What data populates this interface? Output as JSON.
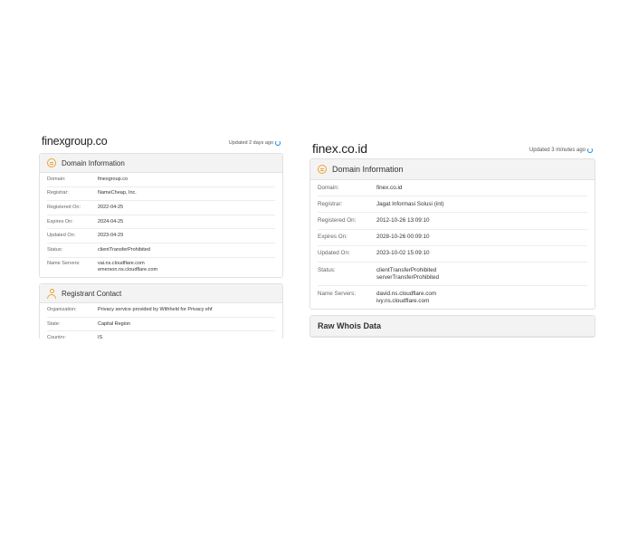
{
  "left": {
    "domain": "finexgroup.co",
    "updated": "Updated 2 days ago",
    "domain_info": {
      "heading": "Domain Information",
      "rows": [
        {
          "label": "Domain:",
          "value": [
            "finexgroup.co"
          ]
        },
        {
          "label": "Registrar:",
          "value": [
            "NameCheap, Inc."
          ]
        },
        {
          "label": "Registered On:",
          "value": [
            "2022-04-25"
          ]
        },
        {
          "label": "Expires On:",
          "value": [
            "2024-04-25"
          ]
        },
        {
          "label": "Updated On:",
          "value": [
            "2023-04-29"
          ]
        },
        {
          "label": "Status:",
          "value": [
            "clientTransferProhibited"
          ]
        },
        {
          "label": "Name Servers:",
          "value": [
            "vai.ns.cloudflare.com",
            "emerson.ns.cloudflare.com"
          ]
        }
      ]
    },
    "registrant": {
      "heading": "Registrant Contact",
      "rows": [
        {
          "label": "Organization:",
          "value": [
            "Privacy service provided by Withheld for Privacy ehf"
          ]
        },
        {
          "label": "State:",
          "value": [
            "Capital Region"
          ]
        },
        {
          "label": "Country:",
          "value": [
            "IS"
          ]
        }
      ]
    }
  },
  "right": {
    "domain": "finex.co.id",
    "updated": "Updated 3 minutes ago",
    "domain_info": {
      "heading": "Domain Information",
      "rows": [
        {
          "label": "Domain:",
          "value": [
            "finex.co.id"
          ]
        },
        {
          "label": "Registrar:",
          "value": [
            "Jagat Informasi Solusi (int)"
          ]
        },
        {
          "label": "Registered On:",
          "value": [
            "2012-10-26 13:09:10"
          ]
        },
        {
          "label": "Expires On:",
          "value": [
            "2028-10-26 00:09:10"
          ]
        },
        {
          "label": "Updated On:",
          "value": [
            "2023-10-02 15:09:10"
          ]
        },
        {
          "label": "Status:",
          "value": [
            "clientTransferProhibited",
            "serverTransferProhibited"
          ]
        },
        {
          "label": "Name Servers:",
          "value": [
            "david.ns.cloudflare.com",
            "ivy.ns.cloudflare.com"
          ]
        }
      ]
    },
    "raw_whois": {
      "heading": "Raw Whois Data"
    }
  },
  "colors": {
    "accent_icon": "#f0a030",
    "refresh_icon": "#1e88e5"
  }
}
